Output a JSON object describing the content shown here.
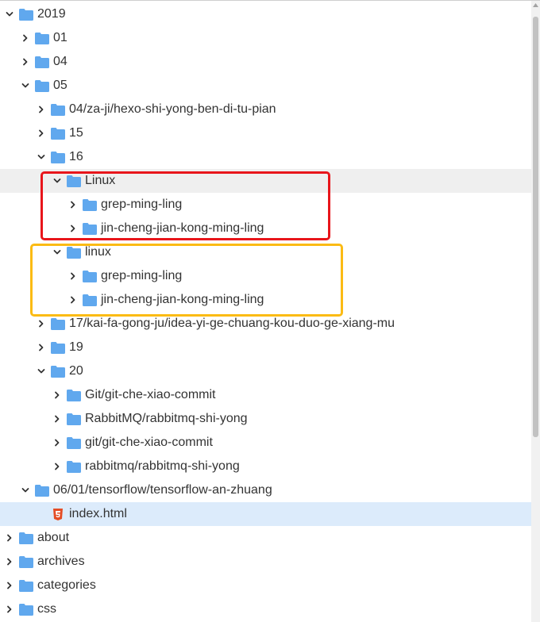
{
  "colors": {
    "folder": "#60a8ee",
    "chevron": "#333333",
    "hover_row": "#efefef",
    "selected_row": "#dcebfb",
    "html_icon": "#e44d26",
    "highlight_red": "#e8151b",
    "highlight_orange": "#fbbb14"
  },
  "tree": {
    "rows": [
      {
        "label": "2019",
        "depth": 0,
        "state": "expanded",
        "icon": "folder-icon"
      },
      {
        "label": "01",
        "depth": 1,
        "state": "collapsed",
        "icon": "folder-icon"
      },
      {
        "label": "04",
        "depth": 1,
        "state": "collapsed",
        "icon": "folder-icon"
      },
      {
        "label": "05",
        "depth": 1,
        "state": "expanded",
        "icon": "folder-icon"
      },
      {
        "label": "04/za-ji/hexo-shi-yong-ben-di-tu-pian",
        "depth": 2,
        "state": "collapsed",
        "icon": "folder-icon"
      },
      {
        "label": "15",
        "depth": 2,
        "state": "collapsed",
        "icon": "folder-icon"
      },
      {
        "label": "16",
        "depth": 2,
        "state": "expanded",
        "icon": "folder-icon"
      },
      {
        "label": "Linux",
        "depth": 3,
        "state": "expanded",
        "icon": "folder-icon",
        "hovered": true
      },
      {
        "label": "grep-ming-ling",
        "depth": 4,
        "state": "collapsed",
        "icon": "folder-icon"
      },
      {
        "label": "jin-cheng-jian-kong-ming-ling",
        "depth": 4,
        "state": "collapsed",
        "icon": "folder-icon"
      },
      {
        "label": "linux",
        "depth": 3,
        "state": "expanded",
        "icon": "folder-icon"
      },
      {
        "label": "grep-ming-ling",
        "depth": 4,
        "state": "collapsed",
        "icon": "folder-icon"
      },
      {
        "label": "jin-cheng-jian-kong-ming-ling",
        "depth": 4,
        "state": "collapsed",
        "icon": "folder-icon"
      },
      {
        "label": "17/kai-fa-gong-ju/idea-yi-ge-chuang-kou-duo-ge-xiang-mu",
        "depth": 2,
        "state": "collapsed",
        "icon": "folder-icon"
      },
      {
        "label": "19",
        "depth": 2,
        "state": "collapsed",
        "icon": "folder-icon"
      },
      {
        "label": "20",
        "depth": 2,
        "state": "expanded",
        "icon": "folder-icon"
      },
      {
        "label": "Git/git-che-xiao-commit",
        "depth": 3,
        "state": "collapsed",
        "icon": "folder-icon"
      },
      {
        "label": "RabbitMQ/rabbitmq-shi-yong",
        "depth": 3,
        "state": "collapsed",
        "icon": "folder-icon"
      },
      {
        "label": "git/git-che-xiao-commit",
        "depth": 3,
        "state": "collapsed",
        "icon": "folder-icon"
      },
      {
        "label": "rabbitmq/rabbitmq-shi-yong",
        "depth": 3,
        "state": "collapsed",
        "icon": "folder-icon"
      },
      {
        "label": "06/01/tensorflow/tensorflow-an-zhuang",
        "depth": 1,
        "state": "expanded",
        "icon": "folder-icon"
      },
      {
        "label": "index.html",
        "depth": 2,
        "state": "leaf",
        "icon": "html5-icon",
        "selected": true
      },
      {
        "label": "about",
        "depth": 0,
        "state": "collapsed",
        "icon": "folder-icon"
      },
      {
        "label": "archives",
        "depth": 0,
        "state": "collapsed",
        "icon": "folder-icon"
      },
      {
        "label": "categories",
        "depth": 0,
        "state": "collapsed",
        "icon": "folder-icon"
      },
      {
        "label": "css",
        "depth": 0,
        "state": "collapsed",
        "icon": "folder-icon"
      }
    ]
  }
}
